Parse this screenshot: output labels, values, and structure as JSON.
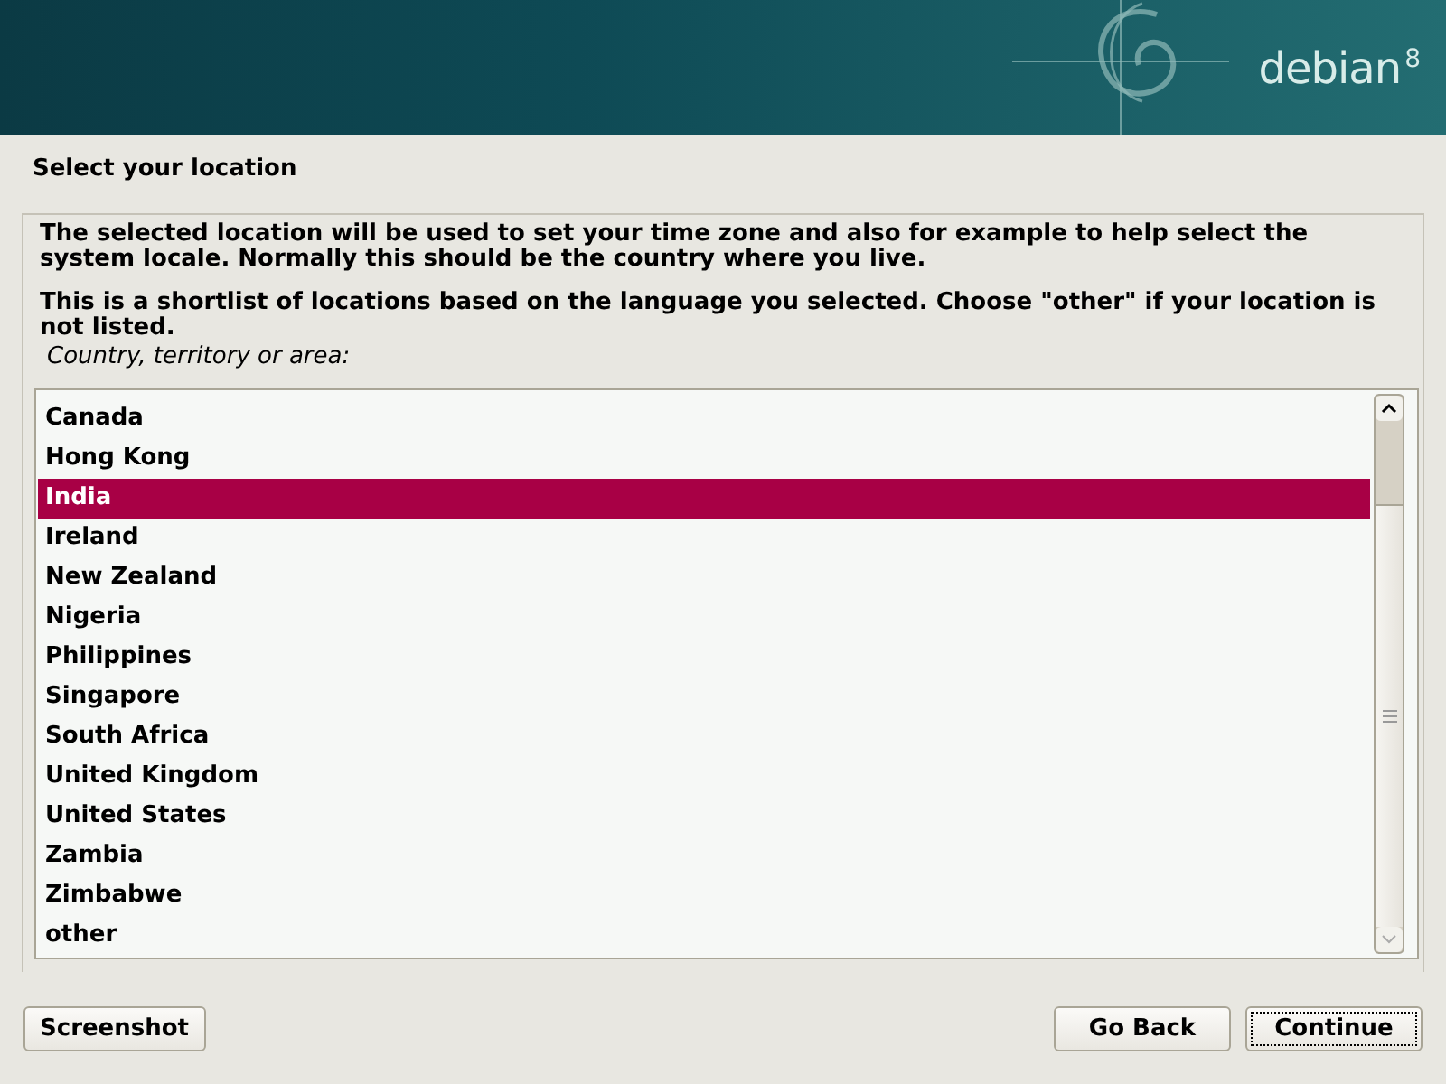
{
  "header": {
    "logo": {
      "name": "debian",
      "version": "8"
    }
  },
  "title": "Select your location",
  "paragraphs": [
    "The selected location will be used to set your time zone and also for example to help select the system locale. Normally this should be the country where you live.",
    "This is a shortlist of locations based on the language you selected. Choose \"other\" if your location is not listed."
  ],
  "list": {
    "label": "Country, territory or area:",
    "items": [
      {
        "label": "Canada",
        "selected": false
      },
      {
        "label": "Hong Kong",
        "selected": false
      },
      {
        "label": "India",
        "selected": true
      },
      {
        "label": "Ireland",
        "selected": false
      },
      {
        "label": "New Zealand",
        "selected": false
      },
      {
        "label": "Nigeria",
        "selected": false
      },
      {
        "label": "Philippines",
        "selected": false
      },
      {
        "label": "Singapore",
        "selected": false
      },
      {
        "label": "South Africa",
        "selected": false
      },
      {
        "label": "United Kingdom",
        "selected": false
      },
      {
        "label": "United States",
        "selected": false
      },
      {
        "label": "Zambia",
        "selected": false
      },
      {
        "label": "Zimbabwe",
        "selected": false
      },
      {
        "label": "other",
        "selected": false
      }
    ]
  },
  "buttons": [
    {
      "label": "Screenshot",
      "focused": false
    },
    {
      "label": "Go Back",
      "focused": false
    },
    {
      "label": "Continue",
      "focused": true
    }
  ]
}
